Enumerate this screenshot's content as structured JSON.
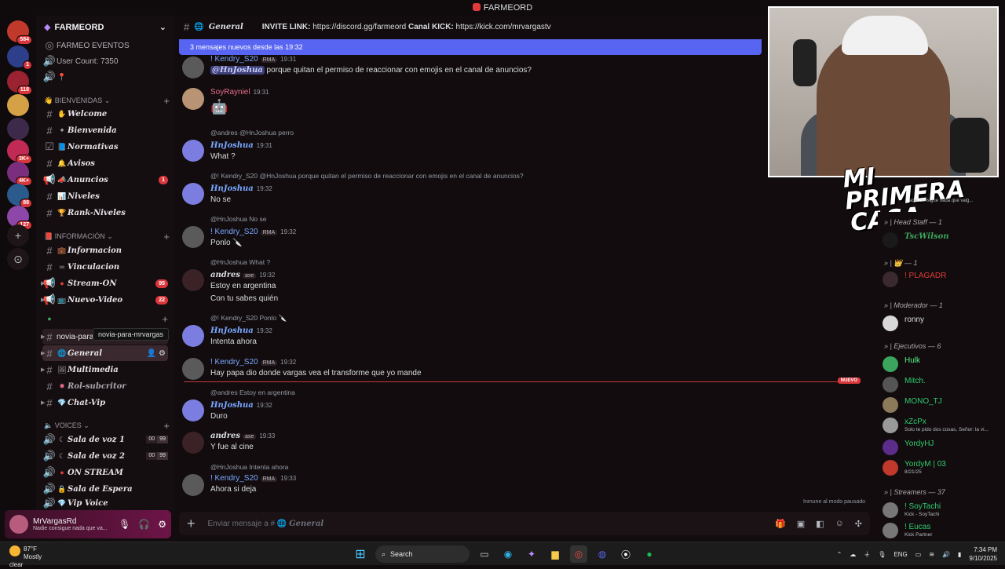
{
  "window_title": "FARMEORD",
  "server": {
    "name": "FARMEORD",
    "top_items": [
      "FARMEO EVENTOS",
      "User Count: 7350"
    ],
    "rail_badges": [
      "584",
      "1",
      "118",
      "3K+",
      "4K+",
      "88",
      "127"
    ]
  },
  "categories": {
    "bienvenidas": "BIENVENIDAS",
    "informacion": "INFORMACIÓN",
    "voices": "VOICES"
  },
  "channels": [
    {
      "name": "Welcome",
      "count": ""
    },
    {
      "name": "Bienvenida",
      "count": ""
    },
    {
      "name": "Normativas",
      "count": ""
    },
    {
      "name": "Avisos",
      "count": ""
    },
    {
      "name": "Anuncios",
      "count": "1"
    },
    {
      "name": "Niveles",
      "count": ""
    },
    {
      "name": "Rank-Niveles",
      "count": ""
    },
    {
      "name": "Informacion",
      "count": ""
    },
    {
      "name": "Vinculacion",
      "count": ""
    },
    {
      "name": "Stream-ON",
      "count": "95"
    },
    {
      "name": "Nuevo-Video",
      "count": "22"
    },
    {
      "name": "novia-para-mrvar...",
      "count": ""
    },
    {
      "name": "General",
      "count": ""
    },
    {
      "name": "Multimedia",
      "count": ""
    },
    {
      "name": "Rol-subcritor",
      "count": ""
    },
    {
      "name": "Chat-Vip",
      "count": ""
    }
  ],
  "tooltip": "novia-para-mrvargas",
  "voices": [
    {
      "name": "Sala de voz 1",
      "a": "00",
      "b": "99"
    },
    {
      "name": "Sala de voz 2",
      "a": "00",
      "b": "99"
    },
    {
      "name": "ON STREAM",
      "a": "",
      "b": ""
    },
    {
      "name": "Sala de Espera",
      "a": "",
      "b": ""
    },
    {
      "name": "Vip Voice",
      "a": "",
      "b": ""
    }
  ],
  "user": {
    "name": "MrVargasRd",
    "status": "Nadie consigue nada que va..."
  },
  "chat": {
    "channel": "General",
    "invite_label": "INVITE LINK:",
    "invite_url": "https://discord.gg/farmeord",
    "kick_label": "Canal KICK:",
    "kick_url": "https://kick.com/mrvargastv",
    "new_messages": "3 mensajes nuevos desde las 19:32",
    "composer_placeholder": "Enviar mensaje a #",
    "composer_channel": "General",
    "nuevo": "NUEVO",
    "typing": "Inmune al modo pausado"
  },
  "messages": [
    {
      "reply": "",
      "author": "! Kendry_S20",
      "tag": "RMA",
      "time": "19:31",
      "body_mention": "@HnJoshua",
      "body": " porque quitan el permiso de reaccionar con emojis en el canal de anuncios?"
    },
    {
      "reply": "",
      "author": "SoyRayniel",
      "tag": "",
      "time": "19:31",
      "body_mention": "",
      "body": ""
    },
    {
      "reply_author": "@andres",
      "reply_text": "@HnJoshua perro",
      "author": "HnJoshua",
      "tag": "",
      "time": "19:31",
      "body": "What ?"
    },
    {
      "reply_author": "@! Kendry_S20",
      "reply_text": "@HnJoshua porque quitan el permiso de reaccionar con emojis en el canal de anuncios?",
      "author": "HnJoshua",
      "tag": "",
      "time": "19:32",
      "body": "No se"
    },
    {
      "reply_author": "@HnJoshua",
      "reply_text": "No se",
      "author": "! Kendry_S20",
      "tag": "RMA",
      "time": "19:32",
      "body": "Ponlo 🔪"
    },
    {
      "reply_author": "@HnJoshua",
      "reply_text": "What ?",
      "author": "andres",
      "tag": "axe",
      "time": "19:32",
      "body": "Estoy en argentina",
      "body2": "Con tu sabes quién"
    },
    {
      "reply_author": "@! Kendry_S20",
      "reply_text": "Ponlo 🔪",
      "author": "HnJoshua",
      "tag": "",
      "time": "19:32",
      "body": "Intenta ahora"
    },
    {
      "reply": "",
      "author": "! Kendry_S20",
      "tag": "RMA",
      "time": "19:32",
      "body": "Hay papa dio donde vargas vea el transforme que yo mande"
    },
    {
      "reply_author": "@andres",
      "reply_text": "Estoy en argentina",
      "author": "HnJoshua",
      "tag": "",
      "time": "19:32",
      "body": "Duro"
    },
    {
      "reply": "",
      "author": "andres",
      "tag": "axe",
      "time": "19:33",
      "body": "Y fue al cine"
    },
    {
      "reply_author": "@HnJoshua",
      "reply_text": "Intenta ahora",
      "author": "! Kendry_S20",
      "tag": "RMA",
      "time": "19:33",
      "body": "Ahora si deja"
    }
  ],
  "overlay": {
    "line1": "MI PRIMERA",
    "line2": "CASA",
    "sub": "adie consigue nada que valg..."
  },
  "members": {
    "roles": [
      "| Head Staff — 1",
      "| 👑 — 1",
      "| Moderador — 1",
      "| Ejecutivos — 6",
      "Streamers — 37"
    ],
    "list": [
      {
        "name": "TscWilson",
        "status": "",
        "color": "#3ba55d"
      },
      {
        "name": "! PLAGADR",
        "status": "",
        "color": "#e03a3a"
      },
      {
        "name": "ronny",
        "status": "",
        "color": "#dbdee1"
      },
      {
        "name": "Hulk",
        "status": "",
        "color": "#57f287"
      },
      {
        "name": "Mitch.",
        "status": "",
        "color": "#2ecc71"
      },
      {
        "name": "MONO_TJ",
        "status": "",
        "color": "#2ecc71"
      },
      {
        "name": "xZcPx",
        "status": "Solo te pido dos cosas, Señor: la vi...",
        "color": "#2ecc71"
      },
      {
        "name": "YordyHJ",
        "status": "",
        "color": "#2ecc71"
      },
      {
        "name": "YordyM | 03",
        "status": "8/21/25",
        "color": "#2ecc71"
      },
      {
        "name": "! SoyTachi",
        "status": "Kick - SoyTachi",
        "color": "#2ecc71"
      },
      {
        "name": "! Eucas",
        "status": "Kick Partner",
        "color": "#2ecc71"
      }
    ]
  },
  "taskbar": {
    "temp": "87°F",
    "weather": "Mostly clear",
    "search": "Search",
    "lang": "ENG",
    "time": "7:34 PM",
    "date": "9/10/2025"
  }
}
